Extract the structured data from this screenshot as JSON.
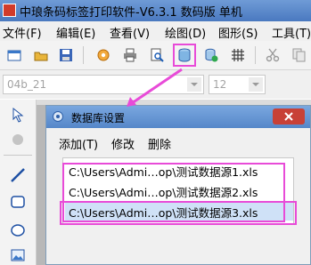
{
  "window": {
    "title": "中琅条码标签打印软件-V6.3.1 数码版 单机"
  },
  "menubar": {
    "items": [
      "文件(F)",
      "编辑(E)",
      "查看(V)",
      "绘图(D)",
      "图形(S)",
      "工具(T)"
    ]
  },
  "toolbar": {
    "icons": [
      "new-icon",
      "open-icon",
      "save-icon",
      "settings-icon",
      "print-icon",
      "print-preview-icon",
      "database-icon",
      "database-add-icon",
      "grid-icon",
      "cut-icon",
      "copy-icon"
    ]
  },
  "properties_bar": {
    "font_value": "04b_21",
    "size_value": "12"
  },
  "left_tools": {
    "icons": [
      "pointer-icon",
      "hand-icon",
      "line-icon",
      "rectangle-icon",
      "ellipse-icon",
      "image-icon"
    ]
  },
  "dialog": {
    "title": "数据库设置",
    "menu": [
      "添加(T)",
      "修改",
      "删除"
    ],
    "items": [
      "C:\\Users\\Admi…op\\测试数据源1.xls",
      "C:\\Users\\Admi…op\\测试数据源2.xls",
      "C:\\Users\\Admi…op\\测试数据源3.xls"
    ],
    "selected_index": 2
  },
  "annotation_color": "#e84bd8"
}
